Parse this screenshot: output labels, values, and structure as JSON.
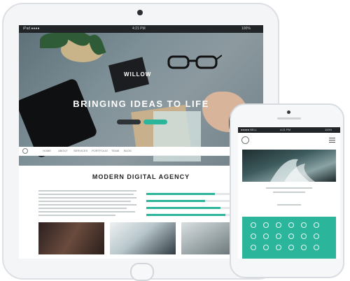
{
  "ipad": {
    "status": {
      "carrier": "iPad ●●●●",
      "time": "4:21 PM",
      "battery": "100%"
    },
    "hero": {
      "logo": "WILLOW",
      "title": "BRINGING IDEAS TO LIFE",
      "subtitle": "",
      "button_primary": "",
      "button_secondary": ""
    },
    "nav": {
      "items": [
        "HOME",
        "ABOUT",
        "SERVICES",
        "PORTFOLIO",
        "TEAM",
        "BLOG"
      ]
    },
    "section": {
      "kicker": "",
      "title": "MODERN DIGITAL AGENCY"
    }
  },
  "iphone": {
    "status": {
      "carrier": "●●●●● BELL",
      "time": "4:21 PM",
      "battery": "100%"
    }
  },
  "colors": {
    "accent": "#2bb59b",
    "dark": "#222528",
    "device_frame": "#dcdfe3"
  }
}
